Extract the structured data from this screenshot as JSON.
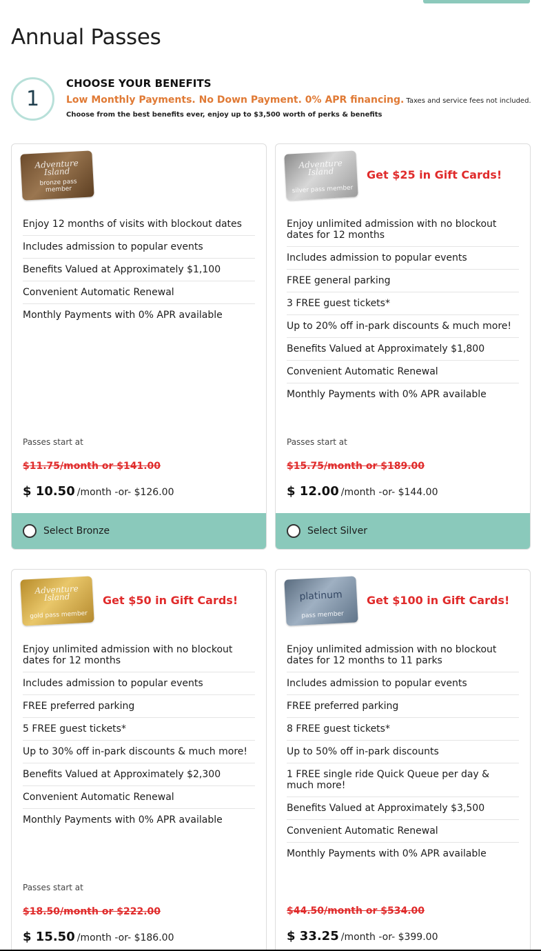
{
  "page": {
    "title": "Annual Passes"
  },
  "step": {
    "number": "1",
    "heading": "CHOOSE YOUR BENEFITS",
    "promo": "Low Monthly Payments. No Down Payment. 0% APR financing.",
    "tax_note": "Taxes and service fees not included.",
    "subtitle": "Choose from the best benefits ever, enjoy up to $3,500 worth of perks & benefits"
  },
  "passes": [
    {
      "logo_brand": "Adventure Island",
      "logo_tier": "bronze pass member",
      "gift": "",
      "benefits": [
        "Enjoy 12 months of visits with blockout dates",
        "Includes admission to popular events",
        "Benefits Valued at Approximately $1,100",
        "Convenient Automatic Renewal",
        "Monthly Payments with 0% APR available"
      ],
      "starts_label": "Passes start at",
      "old_price": "$11.75/month or $141.00",
      "price": "$ 10.50",
      "price_rest": "/month -or- $126.00",
      "select_label": "Select Bronze"
    },
    {
      "logo_brand": "Adventure Island",
      "logo_tier": "silver pass member",
      "gift": "Get $25 in Gift Cards!",
      "benefits": [
        "Enjoy unlimited admission with no blockout dates for 12 months",
        "Includes admission to popular events",
        "FREE general parking",
        "3 FREE guest tickets*",
        "Up to 20% off in-park discounts & much more!",
        "Benefits Valued at Approximately $1,800",
        "Convenient Automatic Renewal",
        "Monthly Payments with 0% APR available"
      ],
      "starts_label": "Passes start at",
      "old_price": "$15.75/month or $189.00",
      "price": "$ 12.00",
      "price_rest": "/month -or- $144.00",
      "select_label": "Select Silver"
    },
    {
      "logo_brand": "Adventure Island",
      "logo_tier": "gold pass member",
      "gift": "Get $50 in Gift Cards!",
      "benefits": [
        "Enjoy unlimited admission with no blockout dates for 12 months",
        "Includes admission to popular events",
        "FREE preferred parking",
        "5 FREE guest tickets*",
        "Up to 30% off in-park discounts & much more!",
        "Benefits Valued at Approximately $2,300",
        "Convenient Automatic Renewal",
        "Monthly Payments with 0% APR available"
      ],
      "starts_label": "Passes start at",
      "old_price": "$18.50/month or $222.00",
      "price": "$ 15.50",
      "price_rest": "/month -or- $186.00"
    },
    {
      "logo_brand": "platinum",
      "logo_tier": "pass member",
      "gift": "Get $100 in Gift Cards!",
      "benefits": [
        "Enjoy unlimited admission with no blockout dates for 12 months to 11 parks",
        "Includes admission to popular events",
        "FREE preferred parking",
        "8 FREE guest tickets*",
        "Up to 50% off in-park discounts",
        "1 FREE single ride Quick Queue per day & much more!",
        "Benefits Valued at Approximately $3,500",
        "Convenient Automatic Renewal",
        "Monthly Payments with 0% APR available"
      ],
      "old_price": "$44.50/month or $534.00",
      "price": "$ 33.25",
      "price_rest": "/month -or- $399.00"
    }
  ]
}
